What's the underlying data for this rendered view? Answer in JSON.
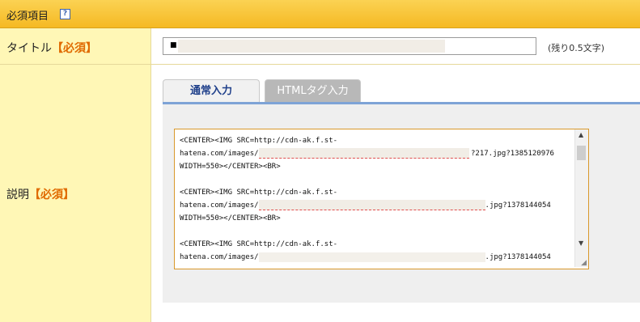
{
  "header": {
    "title": "必須項目",
    "help": "?"
  },
  "fields": {
    "title": {
      "label": "タイトル",
      "required": "【必須】",
      "value": "■",
      "remaining": "(残り0.5文字)"
    },
    "description": {
      "label": "説明",
      "required": "【必須】"
    }
  },
  "tabs": [
    {
      "label": "通常入力",
      "active": true
    },
    {
      "label": "HTMLタグ入力",
      "active": false
    }
  ],
  "editor": {
    "lines": [
      "<CENTER><IMG SRC=http://cdn-ak.f.st-",
      "hatena.com/images/",
      "?217.jpg?1385120976",
      "WIDTH=550></CENTER><BR>",
      "",
      "<CENTER><IMG SRC=http://cdn-ak.f.st-",
      "hatena.com/images/",
      ".jpg?1378144054",
      "WIDTH=550></CENTER><BR>",
      "",
      "<CENTER><IMG SRC=http://cdn-ak.f.st-",
      "hatena.com/images/",
      ".jpg?1378144054"
    ]
  },
  "colors": {
    "header": "#f5b923",
    "label_bg": "#fff7b6",
    "required": "#e06a00",
    "tab_bar": "#7ea3d6"
  }
}
